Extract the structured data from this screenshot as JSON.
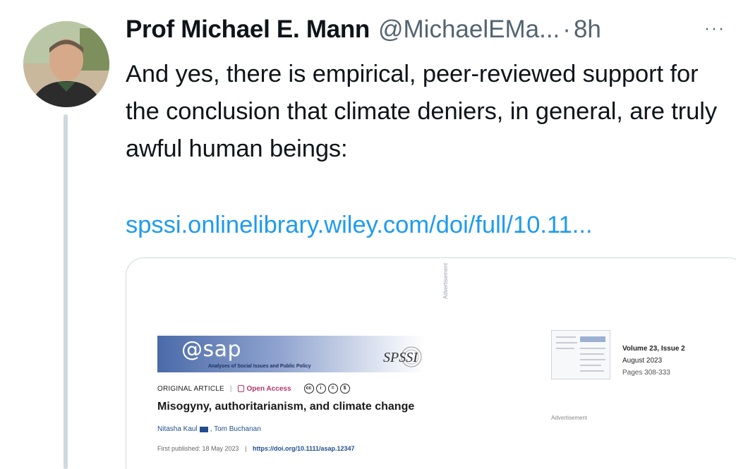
{
  "tweet": {
    "author_name": "Prof Michael E. Mann",
    "author_handle": "@MichaelEMa...",
    "dot": "·",
    "timestamp": "8h",
    "more_label": "···",
    "text": "And yes, there is empirical, peer-reviewed support for the conclusion that climate deniers, in general, are truly awful human beings:",
    "link": "spssi.onlinelibrary.wiley.com/doi/full/10.11..."
  },
  "card": {
    "ad_vertical": "Advertisement",
    "journal_logo": "@sap",
    "journal_subtitle": "Analyses of Social Issues and Public Policy",
    "society_logo": "SPSSI",
    "article_type": "ORIGINAL ARTICLE",
    "separator": "|",
    "open_access": "Open Access",
    "cc_icons": [
      "cc",
      "i",
      "=",
      "$"
    ],
    "title": "Misogyny, authoritarianism, and climate change",
    "author_1": "Nitasha Kaul",
    "author_2": ", Tom Buchanan",
    "first_published_label": "First published: 18 May 2023",
    "doi": "https://doi.org/10.1111/asap.12347",
    "issue_volume": "Volume 23, Issue 2",
    "issue_date": "August 2023",
    "issue_pages": "Pages 308-333",
    "ad_bottom": "Advertisement"
  },
  "colors": {
    "link": "#1d9bf0",
    "secondary_text": "#536471",
    "open_access": "#b5356a",
    "thread_line": "#cfd9de"
  }
}
